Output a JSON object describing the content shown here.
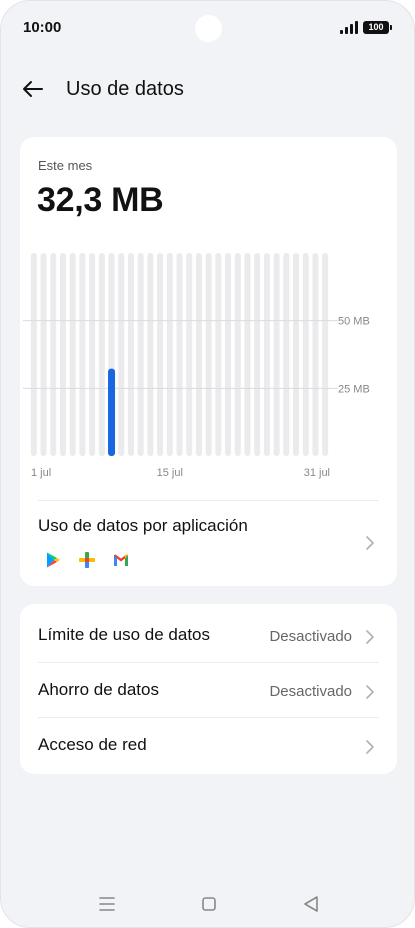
{
  "status_bar": {
    "time": "10:00",
    "battery": "100",
    "icons": [
      "signal-icon",
      "battery-icon"
    ]
  },
  "header": {
    "title": "Uso de datos",
    "back_icon": "arrow-left-icon"
  },
  "usage": {
    "period_label": "Este mes",
    "total": "32,3 MB"
  },
  "chart_data": {
    "type": "bar",
    "x": [
      "1 jul",
      "2 jul",
      "3 jul",
      "4 jul",
      "5 jul",
      "6 jul",
      "7 jul",
      "8 jul",
      "9 jul",
      "10 jul",
      "11 jul",
      "12 jul",
      "13 jul",
      "14 jul",
      "15 jul",
      "16 jul",
      "17 jul",
      "18 jul",
      "19 jul",
      "20 jul",
      "21 jul",
      "22 jul",
      "23 jul",
      "24 jul",
      "25 jul",
      "26 jul",
      "27 jul",
      "28 jul",
      "29 jul",
      "30 jul",
      "31 jul"
    ],
    "values": [
      0,
      0,
      0,
      0,
      0,
      0,
      0,
      0,
      32.3,
      0,
      0,
      0,
      0,
      0,
      0,
      0,
      0,
      0,
      0,
      0,
      0,
      0,
      0,
      0,
      0,
      0,
      0,
      0,
      0,
      0,
      0
    ],
    "x_tick_labels": [
      "1 jul",
      "15 jul",
      "31 jul"
    ],
    "y_tick_labels": [
      "50 MB",
      "25 MB"
    ],
    "y_ticks": [
      50,
      25
    ],
    "ylim": [
      0,
      75
    ],
    "grid": true,
    "colors": {
      "bar": "#1a66e0",
      "track": "#ebebed",
      "grid": "#dcdcdf"
    }
  },
  "app_usage": {
    "label": "Uso de datos por aplicación",
    "apps": [
      "google-play-icon",
      "google-one-icon",
      "gmail-icon"
    ]
  },
  "settings": [
    {
      "label": "Límite de uso de datos",
      "value": "Desactivado"
    },
    {
      "label": "Ahorro de datos",
      "value": "Desactivado"
    },
    {
      "label": "Acceso de red",
      "value": ""
    }
  ],
  "nav_bar": {
    "buttons": [
      "menu-icon",
      "home-icon",
      "back-icon"
    ]
  }
}
